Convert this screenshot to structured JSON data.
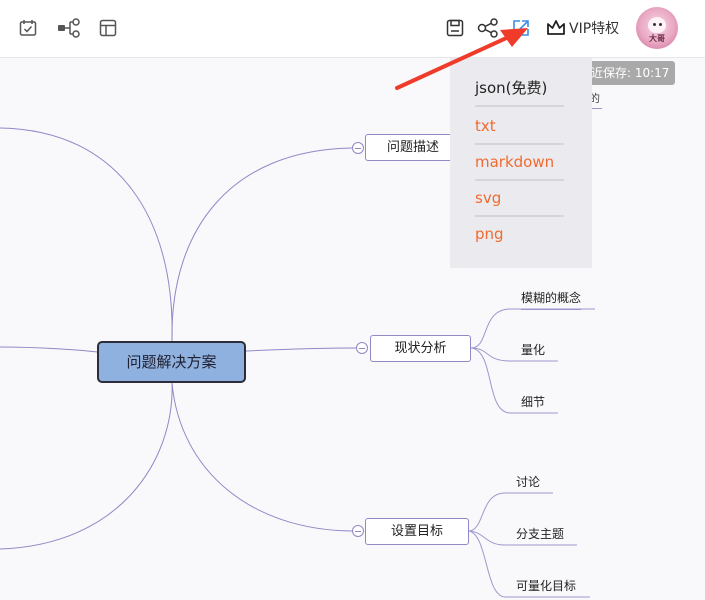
{
  "toolbar": {
    "icons": [
      "calendar-check-icon",
      "structure-icon",
      "layout-icon",
      "save-icon",
      "share-icon",
      "export-icon"
    ],
    "vip_label": "VIP特权",
    "avatar_text": "大哥"
  },
  "save_status": "近保存: 10:17",
  "export_menu": {
    "items": [
      {
        "label": "json(免费)",
        "style": "normal"
      },
      {
        "label": "txt",
        "style": "orange"
      },
      {
        "label": "markdown",
        "style": "orange"
      },
      {
        "label": "svg",
        "style": "orange"
      },
      {
        "label": "png",
        "style": "orange"
      }
    ],
    "peek_text": "的"
  },
  "mindmap": {
    "root": "问题解决方案",
    "branches": [
      {
        "label": "问题描述",
        "children": []
      },
      {
        "label": "现状分析",
        "children": [
          "模糊的概念",
          "量化",
          "细节"
        ]
      },
      {
        "label": "设置目标",
        "children": [
          "讨论",
          "分支主题",
          "可量化目标"
        ]
      }
    ]
  },
  "colors": {
    "accent_orange": "#f06a2f",
    "root_fill": "#8fb1e0",
    "line": "#8f89c6",
    "arrow": "#f03a2a",
    "export_icon": "#3a8ee6"
  }
}
